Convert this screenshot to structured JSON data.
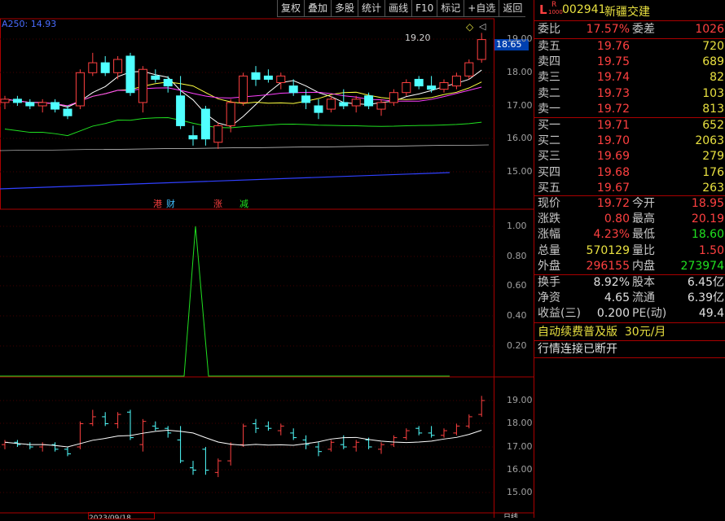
{
  "toolbar": [
    "复权",
    "叠加",
    "多股",
    "统计",
    "画线",
    "F10",
    "标记",
    "+自选",
    "返回"
  ],
  "ma_label": "A250: 14.93",
  "price_labels": [
    "19.00",
    "18.00",
    "17.00",
    "16.00",
    "15.00"
  ],
  "price_tag": "18.65",
  "high_marker": "19.20",
  "indicator_labels": [
    "1.00",
    "0.80",
    "0.60",
    "0.40",
    "0.20"
  ],
  "lower_labels": [
    "19.00",
    "18.00",
    "17.00",
    "16.00",
    "15.00"
  ],
  "event_tags": [
    {
      "text": "港",
      "color": "#ff4040"
    },
    {
      "text": "财",
      "color": "#40c0ff"
    },
    {
      "text": "涨",
      "color": "#ff4040"
    },
    {
      "text": "减",
      "color": "#20e020"
    }
  ],
  "bottom_date": "2023/09/18",
  "bottom_right": "日线",
  "stock": {
    "prefix": "L",
    "tag": "R",
    "tag_sub": "1000",
    "code": "002941",
    "name": "新疆交建"
  },
  "ratio": {
    "label": "委比",
    "value": "17.57%",
    "label2": "委差",
    "value2": "1026"
  },
  "asks": [
    {
      "label": "卖五",
      "price": "19.76",
      "vol": "720"
    },
    {
      "label": "卖四",
      "price": "19.75",
      "vol": "689"
    },
    {
      "label": "卖三",
      "price": "19.74",
      "vol": "82"
    },
    {
      "label": "卖二",
      "price": "19.73",
      "vol": "103"
    },
    {
      "label": "卖一",
      "price": "19.72",
      "vol": "813"
    }
  ],
  "bids": [
    {
      "label": "买一",
      "price": "19.71",
      "vol": "652"
    },
    {
      "label": "买二",
      "price": "19.70",
      "vol": "2063"
    },
    {
      "label": "买三",
      "price": "19.69",
      "vol": "279"
    },
    {
      "label": "买四",
      "price": "19.68",
      "vol": "176"
    },
    {
      "label": "买五",
      "price": "19.67",
      "vol": "263"
    }
  ],
  "quote": [
    {
      "l1": "现价",
      "v1": "19.72",
      "c1": "red",
      "l2": "今开",
      "v2": "18.95",
      "c2": "red"
    },
    {
      "l1": "涨跌",
      "v1": "0.80",
      "c1": "red",
      "l2": "最高",
      "v2": "20.19",
      "c2": "red"
    },
    {
      "l1": "涨幅",
      "v1": "4.23%",
      "c1": "red",
      "l2": "最低",
      "v2": "18.60",
      "c2": "grn"
    },
    {
      "l1": "总量",
      "v1": "570129",
      "c1": "yel",
      "l2": "量比",
      "v2": "1.50",
      "c2": "red"
    },
    {
      "l1": "外盘",
      "v1": "296155",
      "c1": "red",
      "l2": "内盘",
      "v2": "273974",
      "c2": "grn"
    }
  ],
  "fund": [
    {
      "l1": "换手",
      "v1": "8.92%",
      "l2": "股本",
      "v2": "6.45亿"
    },
    {
      "l1": "净资",
      "v1": "4.65",
      "l2": "流通",
      "v2": "6.39亿"
    },
    {
      "l1": "收益(三)",
      "v1": "0.200",
      "l2": "PE(动)",
      "v2": "49.4"
    }
  ],
  "promo": "自动续费普及版  30元/月",
  "status": "行情连接已断开"
}
